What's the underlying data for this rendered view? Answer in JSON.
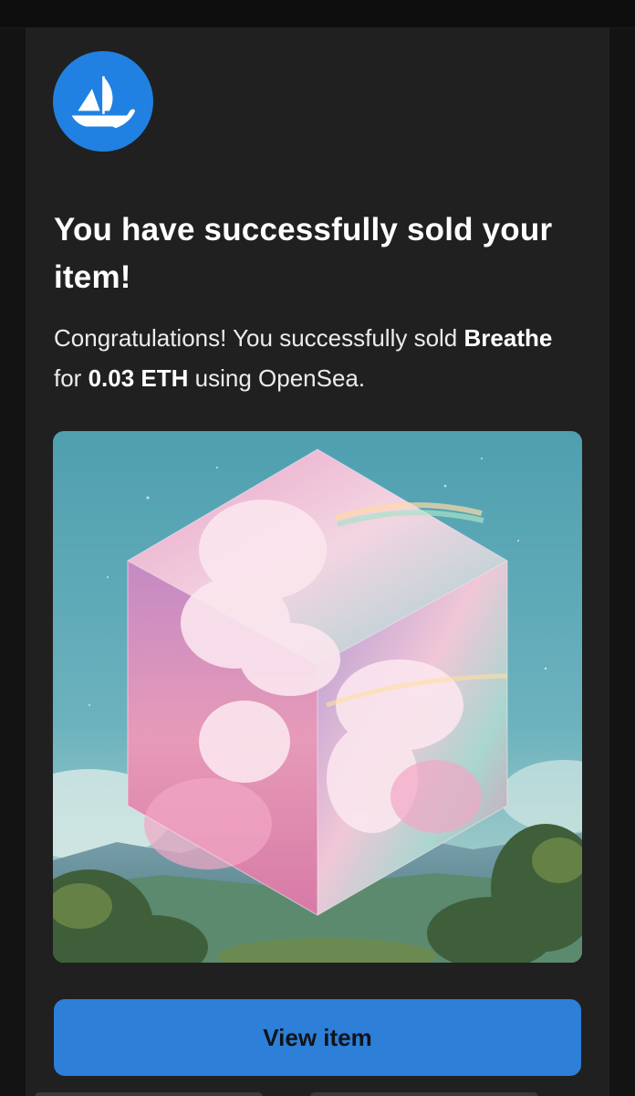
{
  "email": {
    "logo": {
      "icon": "opensea-ship-icon",
      "color": "#2081e2"
    },
    "title": "You have successfully sold your item!",
    "message": {
      "intro": "Congratulations! You successfully sold",
      "item_name": "Breathe",
      "for_word": "for",
      "price": "0.03 ETH",
      "outro": "using OpenSea."
    },
    "artwork": {
      "subject": "cube-of-clouds-artwork"
    },
    "view_button_label": "View item",
    "accent_color": "#2d7fd8"
  }
}
